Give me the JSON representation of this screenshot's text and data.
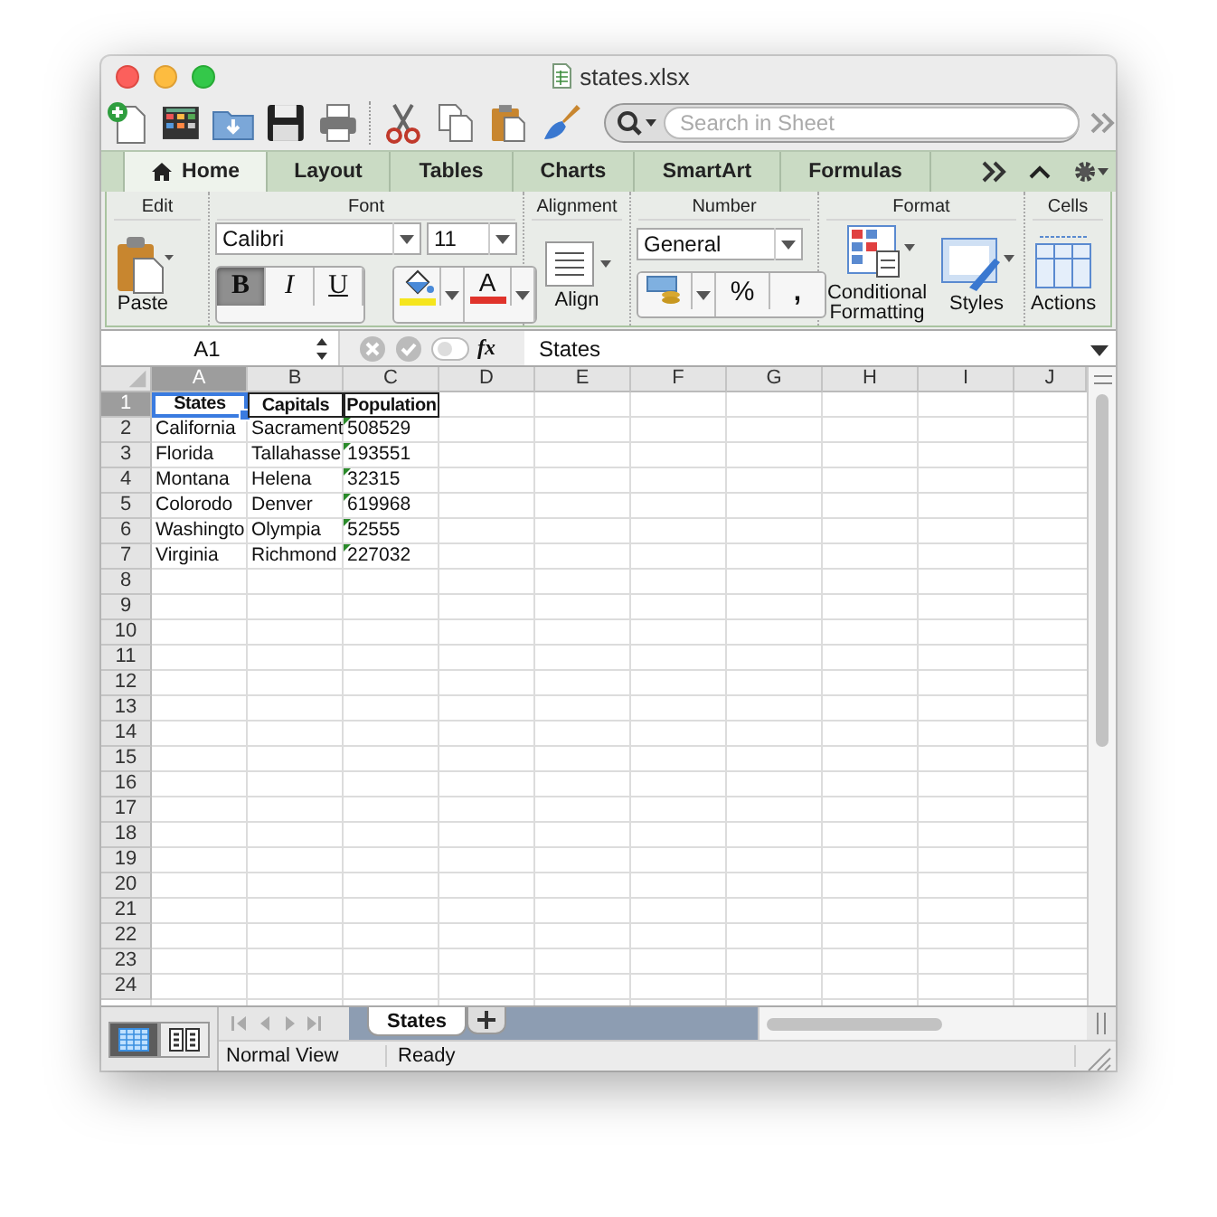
{
  "window": {
    "title": "states.xlsx"
  },
  "toolbar": {
    "search": {
      "placeholder": "Search in Sheet"
    }
  },
  "ribbon_tabs": [
    {
      "label": "Home",
      "selected": true
    },
    {
      "label": "Layout",
      "selected": false
    },
    {
      "label": "Tables",
      "selected": false
    },
    {
      "label": "Charts",
      "selected": false
    },
    {
      "label": "SmartArt",
      "selected": false
    },
    {
      "label": "Formulas",
      "selected": false
    }
  ],
  "ribbon": {
    "groups": [
      {
        "label": "Edit"
      },
      {
        "label": "Font"
      },
      {
        "label": "Alignment"
      },
      {
        "label": "Number"
      },
      {
        "label": "Format"
      },
      {
        "label": "Cells"
      }
    ],
    "paste": "Paste",
    "font_name": "Calibri",
    "font_size": "11",
    "bold": true,
    "italic": false,
    "underline": false,
    "bold_label": "B",
    "italic_label": "I",
    "underline_label": "U",
    "font_color_label": "A",
    "align": "Align",
    "number_format": "General",
    "percent": "%",
    "comma": ",",
    "conditional": "Conditional Formatting",
    "styles": "Styles",
    "actions": "Actions"
  },
  "formula_bar": {
    "name_box": "A1",
    "fx": "fx",
    "content": "States"
  },
  "sheet": {
    "columns": [
      {
        "label": "A",
        "selected": true
      },
      {
        "label": "B",
        "selected": false
      },
      {
        "label": "C",
        "selected": false
      },
      {
        "label": "D",
        "selected": false
      },
      {
        "label": "E",
        "selected": false
      },
      {
        "label": "F",
        "selected": false
      },
      {
        "label": "G",
        "selected": false
      },
      {
        "label": "H",
        "selected": false
      },
      {
        "label": "I",
        "selected": false
      },
      {
        "label": "J",
        "selected": false
      }
    ],
    "rows": [
      {
        "label": "1",
        "selected": true,
        "cells": [
          {
            "text": "States",
            "kind": "header",
            "selected": true
          },
          {
            "text": "Capitals",
            "kind": "header",
            "selected": false
          },
          {
            "text": "Population",
            "kind": "header",
            "selected": false
          }
        ]
      },
      {
        "label": "2",
        "selected": false,
        "cells": [
          {
            "text": "California",
            "kind": "plain",
            "selected": false
          },
          {
            "text": "Sacrament",
            "kind": "plain",
            "selected": false
          },
          {
            "text": "508529",
            "kind": "number_text",
            "selected": false
          }
        ]
      },
      {
        "label": "3",
        "selected": false,
        "cells": [
          {
            "text": "Florida",
            "kind": "plain",
            "selected": false
          },
          {
            "text": "Tallahasse",
            "kind": "plain",
            "selected": false
          },
          {
            "text": "193551",
            "kind": "number_text",
            "selected": false
          }
        ]
      },
      {
        "label": "4",
        "selected": false,
        "cells": [
          {
            "text": "Montana",
            "kind": "plain",
            "selected": false
          },
          {
            "text": "Helena",
            "kind": "plain",
            "selected": false
          },
          {
            "text": "32315",
            "kind": "number_text",
            "selected": false
          }
        ]
      },
      {
        "label": "5",
        "selected": false,
        "cells": [
          {
            "text": "Colorodo",
            "kind": "plain",
            "selected": false
          },
          {
            "text": "Denver",
            "kind": "plain",
            "selected": false
          },
          {
            "text": "619968",
            "kind": "number_text",
            "selected": false
          }
        ]
      },
      {
        "label": "6",
        "selected": false,
        "cells": [
          {
            "text": "Washingto",
            "kind": "plain",
            "selected": false
          },
          {
            "text": "Olympia",
            "kind": "plain",
            "selected": false
          },
          {
            "text": "52555",
            "kind": "number_text",
            "selected": false
          }
        ]
      },
      {
        "label": "7",
        "selected": false,
        "cells": [
          {
            "text": "Virginia",
            "kind": "plain",
            "selected": false
          },
          {
            "text": "Richmond",
            "kind": "plain",
            "selected": false
          },
          {
            "text": "227032",
            "kind": "number_text",
            "selected": false
          }
        ]
      },
      {
        "label": "8",
        "selected": false,
        "cells": []
      },
      {
        "label": "9",
        "selected": false,
        "cells": []
      },
      {
        "label": "10",
        "selected": false,
        "cells": []
      },
      {
        "label": "11",
        "selected": false,
        "cells": []
      },
      {
        "label": "12",
        "selected": false,
        "cells": []
      },
      {
        "label": "13",
        "selected": false,
        "cells": []
      },
      {
        "label": "14",
        "selected": false,
        "cells": []
      },
      {
        "label": "15",
        "selected": false,
        "cells": []
      },
      {
        "label": "16",
        "selected": false,
        "cells": []
      },
      {
        "label": "17",
        "selected": false,
        "cells": []
      },
      {
        "label": "18",
        "selected": false,
        "cells": []
      },
      {
        "label": "19",
        "selected": false,
        "cells": []
      },
      {
        "label": "20",
        "selected": false,
        "cells": []
      },
      {
        "label": "21",
        "selected": false,
        "cells": []
      },
      {
        "label": "22",
        "selected": false,
        "cells": []
      },
      {
        "label": "23",
        "selected": false,
        "cells": []
      },
      {
        "label": "24",
        "selected": false,
        "cells": []
      }
    ]
  },
  "sheet_tabs": [
    {
      "label": "States",
      "selected": true
    }
  ],
  "views": [
    {
      "kind": "normal",
      "selected": true
    },
    {
      "kind": "page_layout",
      "selected": false
    }
  ],
  "status_bar": {
    "view": "Normal View",
    "state": "Ready"
  }
}
